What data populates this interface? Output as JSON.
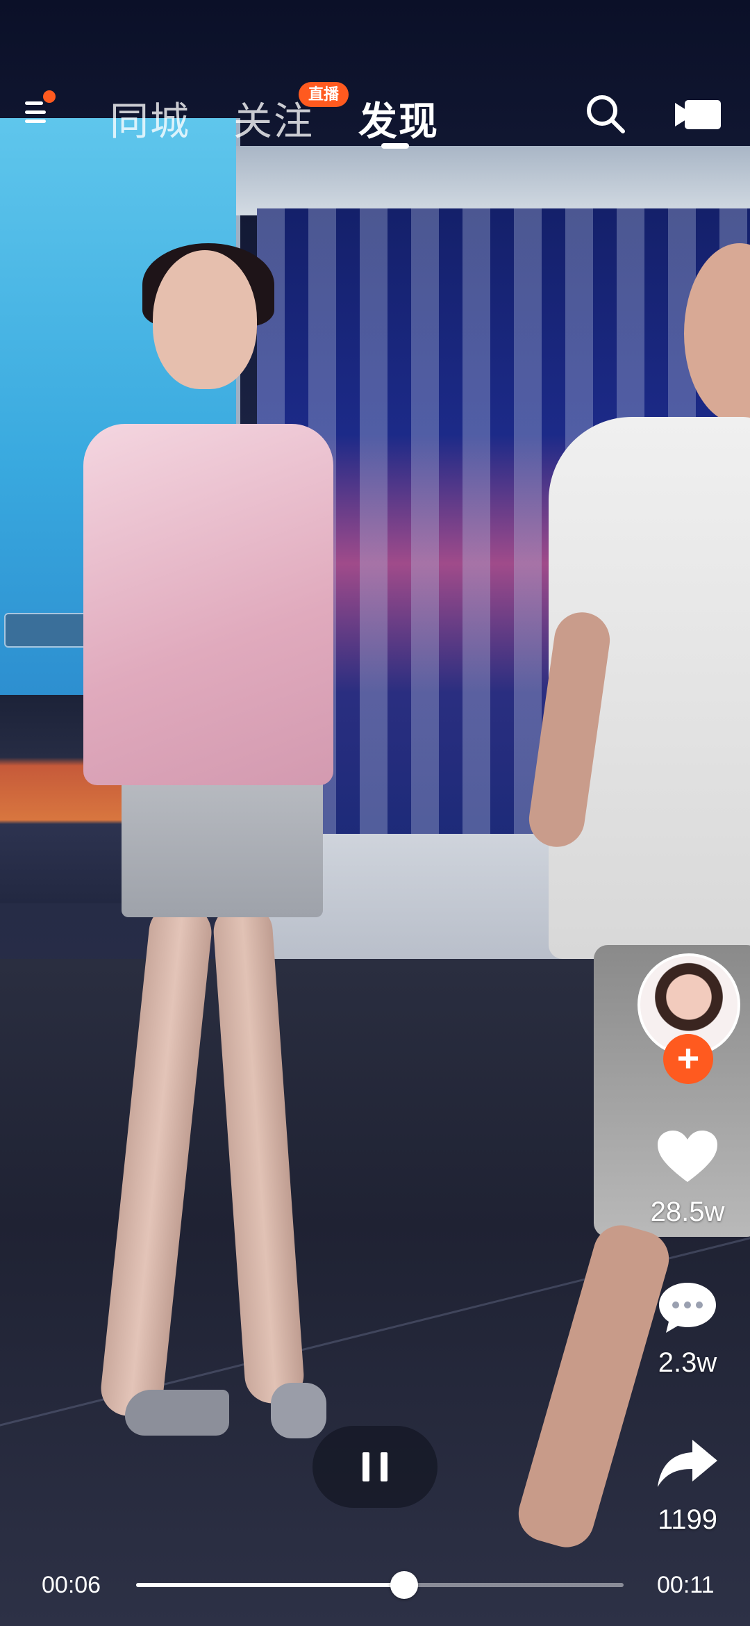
{
  "topnav": {
    "menu_has_notification": true,
    "tabs": [
      {
        "label": "同城",
        "active": false
      },
      {
        "label": "关注",
        "active": false,
        "badge": "直播"
      },
      {
        "label": "发现",
        "active": true
      }
    ],
    "icons": {
      "menu": "menu-icon",
      "search": "search-icon",
      "camera": "video-camera-icon"
    },
    "accent_color": "#ff5a1f"
  },
  "right_rail": {
    "follow_label": "+",
    "likes": "28.5w",
    "comments": "2.3w",
    "shares": "1199",
    "icons": {
      "like": "heart-icon",
      "comment": "comment-icon",
      "share": "share-icon"
    }
  },
  "player": {
    "current_time": "00:06",
    "total_time": "00:11",
    "progress_fraction": 0.55,
    "state": "playing",
    "pause_icon": "pause-icon"
  }
}
